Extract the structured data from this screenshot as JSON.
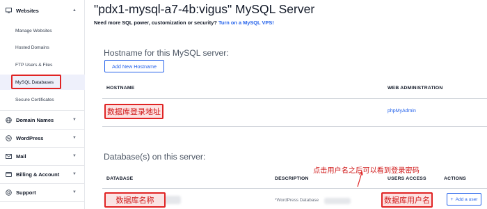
{
  "sidebar": {
    "websites": {
      "label": "Websites",
      "icon": "monitor-icon"
    },
    "items": [
      {
        "label": "Manage Websites"
      },
      {
        "label": "Hosted Domains"
      },
      {
        "label": "FTP Users & Files"
      },
      {
        "label": "MySQL Databases",
        "active": true
      },
      {
        "label": "Secure Certificates"
      }
    ],
    "sections": [
      {
        "label": "Domain Names",
        "icon": "globe-icon"
      },
      {
        "label": "WordPress",
        "icon": "wordpress-icon"
      },
      {
        "label": "Mail",
        "icon": "mail-icon"
      },
      {
        "label": "Billing & Account",
        "icon": "billing-icon"
      },
      {
        "label": "Support",
        "icon": "support-icon"
      }
    ]
  },
  "main": {
    "title": "\"pdx1-mysql-a7-4b:vigus\" MySQL Server",
    "upsell_text": "Need more SQL power, customization or security?",
    "upsell_link": "Turn on a MySQL VPS!",
    "hostname_section": {
      "heading": "Hostname for this MySQL server:",
      "add_button": "Add New Hostname",
      "col_hostname": "HOSTNAME",
      "col_web_admin": "WEB ADMINISTRATION",
      "row_hostname_annotation": "数据库登录地址",
      "row_admin_link": "phpMyAdmin"
    },
    "database_section": {
      "heading": "Database(s) on this server:",
      "col_database": "DATABASE",
      "col_description": "DESCRIPTION",
      "col_users_access": "USERS ACCESS",
      "col_actions": "ACTIONS",
      "row_database_annotation": "数据库名称",
      "row_description": "*WordPress Database",
      "row_user_annotation": "数据库用户名",
      "add_user_button": "Add a user"
    },
    "click_hint_annotation": "点击用户名之后可以看到登录密码"
  },
  "colors": {
    "accent": "#2563eb",
    "annotation_red": "#e02424",
    "active_bg": "#eef0fb"
  }
}
